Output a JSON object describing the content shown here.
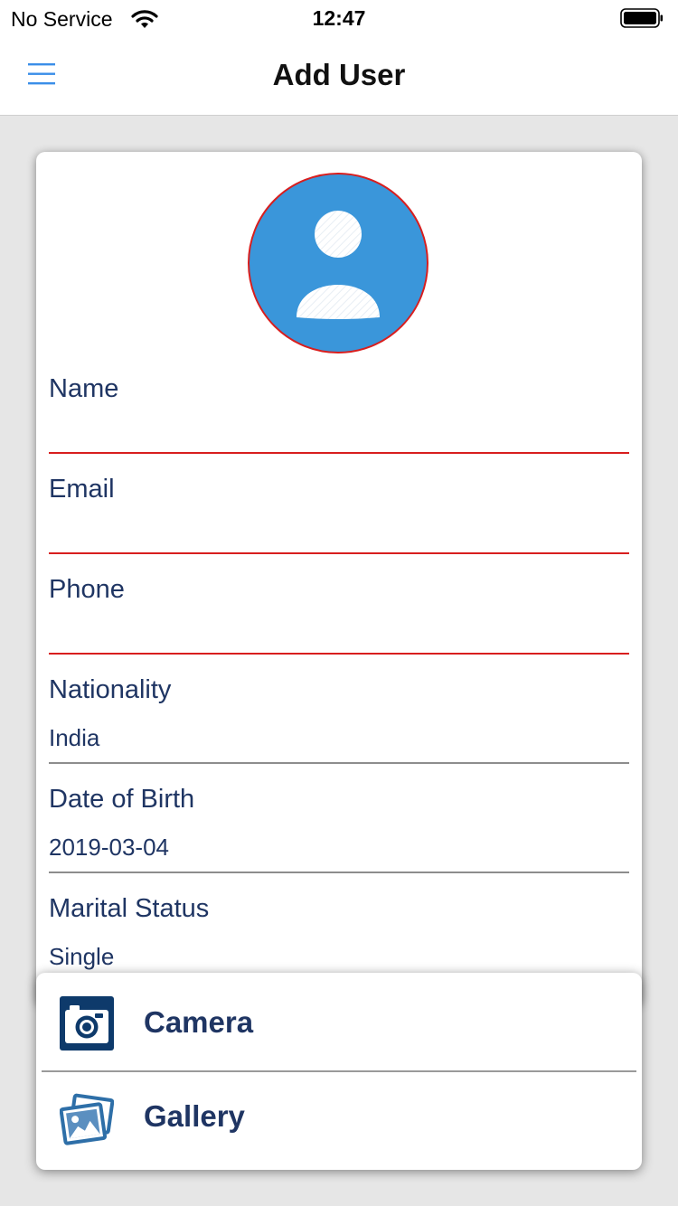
{
  "status_bar": {
    "carrier": "No Service",
    "time": "12:47"
  },
  "nav": {
    "title": "Add User",
    "menu_icon": "hamburger-menu-icon",
    "accent_color": "#3a8ee8"
  },
  "form": {
    "avatar_icon": "user-silhouette-icon",
    "avatar_color": "#3a96da",
    "fields": [
      {
        "label": "Name",
        "value": ""
      },
      {
        "label": "Email",
        "value": ""
      },
      {
        "label": "Phone",
        "value": ""
      },
      {
        "label": "Nationality",
        "value": "India"
      },
      {
        "label": "Date of Birth",
        "value": "2019-03-04"
      },
      {
        "label": "Marital Status",
        "value": "Single"
      }
    ],
    "error_color": "#d81e1e",
    "text_color": "#1f3563"
  },
  "picker": {
    "options": [
      {
        "label": "Camera",
        "icon": "camera-icon"
      },
      {
        "label": "Gallery",
        "icon": "gallery-icon"
      }
    ]
  }
}
